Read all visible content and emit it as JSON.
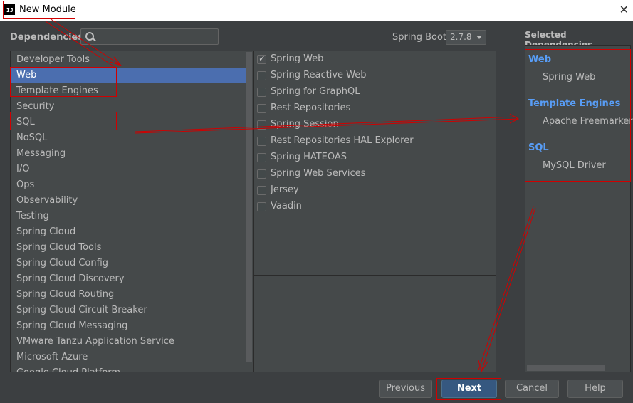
{
  "window": {
    "title": "New Module",
    "app_icon_text": "IJ",
    "close_symbol": "✕"
  },
  "search": {
    "label": "Dependencies",
    "value": "",
    "placeholder": ""
  },
  "spring_boot": {
    "label": "Spring Boot",
    "version": "2.7.8"
  },
  "categories": [
    {
      "label": "Developer Tools"
    },
    {
      "label": "Web",
      "selected": true
    },
    {
      "label": "Template Engines"
    },
    {
      "label": "Security"
    },
    {
      "label": "SQL"
    },
    {
      "label": "NoSQL"
    },
    {
      "label": "Messaging"
    },
    {
      "label": "I/O"
    },
    {
      "label": "Ops"
    },
    {
      "label": "Observability"
    },
    {
      "label": "Testing"
    },
    {
      "label": "Spring Cloud"
    },
    {
      "label": "Spring Cloud Tools"
    },
    {
      "label": "Spring Cloud Config"
    },
    {
      "label": "Spring Cloud Discovery"
    },
    {
      "label": "Spring Cloud Routing"
    },
    {
      "label": "Spring Cloud Circuit Breaker"
    },
    {
      "label": "Spring Cloud Messaging"
    },
    {
      "label": "VMware Tanzu Application Service"
    },
    {
      "label": "Microsoft Azure"
    },
    {
      "label": "Google Cloud Platform"
    }
  ],
  "dependencies": [
    {
      "label": "Spring Web",
      "checked": true
    },
    {
      "label": "Spring Reactive Web",
      "checked": false
    },
    {
      "label": "Spring for GraphQL",
      "checked": false
    },
    {
      "label": "Rest Repositories",
      "checked": false
    },
    {
      "label": "Spring Session",
      "checked": false
    },
    {
      "label": "Rest Repositories HAL Explorer",
      "checked": false
    },
    {
      "label": "Spring HATEOAS",
      "checked": false
    },
    {
      "label": "Spring Web Services",
      "checked": false
    },
    {
      "label": "Jersey",
      "checked": false
    },
    {
      "label": "Vaadin",
      "checked": false
    }
  ],
  "selected": {
    "title": "Selected Dependencies",
    "sections": [
      {
        "title": "Web",
        "items": [
          "Spring Web"
        ]
      },
      {
        "title": "Template Engines",
        "items": [
          "Apache Freemarker"
        ]
      },
      {
        "title": "SQL",
        "items": [
          "MySQL Driver"
        ]
      }
    ]
  },
  "buttons": {
    "previous": {
      "mnemonic": "P",
      "rest": "revious"
    },
    "next": {
      "mnemonic": "N",
      "rest": "ext"
    },
    "cancel": "Cancel",
    "help": "Help"
  },
  "colors": {
    "accent": "#4b6eaf",
    "section_title": "#589df6",
    "annotation": "#d00000",
    "primary_button": "#365880"
  }
}
